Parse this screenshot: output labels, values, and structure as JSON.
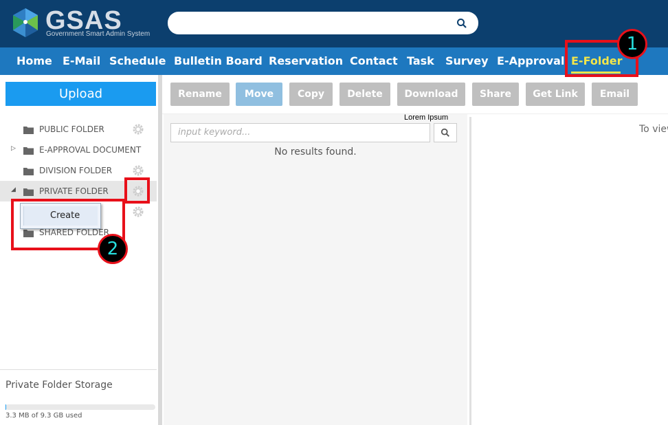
{
  "app": {
    "logo_text": "GSAS",
    "logo_subtitle": "Government Smart Admin System"
  },
  "search": {
    "placeholder": ""
  },
  "nav": {
    "items": [
      "Home",
      "E-Mail",
      "Schedule",
      "Bulletin Board",
      "Reservation",
      "Contact",
      "Task",
      "Survey",
      "E-Approval",
      "E-Folder"
    ],
    "active": "E-Folder"
  },
  "sidebar": {
    "upload_label": "Upload",
    "folders": [
      {
        "label": "PUBLIC FOLDER"
      },
      {
        "label": "E-APPROVAL DOCUMENT"
      },
      {
        "label": "DIVISION FOLDER"
      },
      {
        "label": "PRIVATE FOLDER"
      },
      {
        "label": ""
      },
      {
        "label": "SHARED FOLDER"
      }
    ],
    "storage_title": "Private Folder Storage",
    "storage_used": "3.3 MB of 9.3 GB used"
  },
  "toolbar": {
    "buttons": [
      "Rename",
      "Move",
      "Copy",
      "Delete",
      "Download",
      "Share",
      "Get Link",
      "Email"
    ]
  },
  "list": {
    "tooltip": "Lorem Ipsum",
    "keyword_placeholder": "input keyword...",
    "empty_text": "No results found."
  },
  "detail": {
    "text": "To view"
  },
  "context_menu": {
    "create_label": "Create"
  },
  "annotations": {
    "badge1": "1",
    "badge2": "2"
  },
  "colors": {
    "header": "#0c3f6e",
    "navbar": "#1e78bf",
    "active": "#f3e64a",
    "accent": "#1a9bf0",
    "highlight": "#e8101a"
  }
}
